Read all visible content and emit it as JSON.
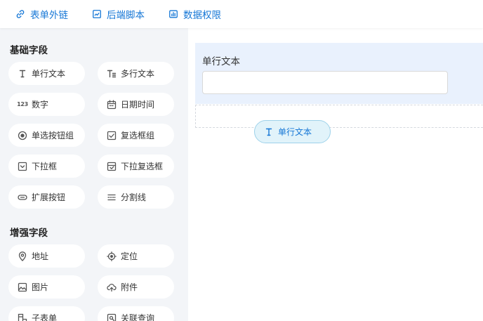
{
  "toolbar": {
    "items": [
      {
        "label": "表单外链",
        "icon": "link-icon"
      },
      {
        "label": "后端脚本",
        "icon": "script-icon"
      },
      {
        "label": "数据权限",
        "icon": "bar-chart-icon"
      }
    ]
  },
  "palette": {
    "sections": [
      {
        "title": "基础字段",
        "items": [
          {
            "label": "单行文本",
            "icon": "single-line-text-icon"
          },
          {
            "label": "多行文本",
            "icon": "multi-line-text-icon"
          },
          {
            "label": "数字",
            "icon": "number-icon",
            "icon_text": "123"
          },
          {
            "label": "日期时间",
            "icon": "calendar-icon"
          },
          {
            "label": "单选按钮组",
            "icon": "radio-icon"
          },
          {
            "label": "复选框组",
            "icon": "checkbox-icon"
          },
          {
            "label": "下拉框",
            "icon": "dropdown-icon"
          },
          {
            "label": "下拉复选框",
            "icon": "dropdown-checkbox-icon"
          },
          {
            "label": "扩展按钮",
            "icon": "extend-button-icon"
          },
          {
            "label": "分割线",
            "icon": "divider-icon"
          }
        ]
      },
      {
        "title": "增强字段",
        "items": [
          {
            "label": "地址",
            "icon": "location-pin-icon"
          },
          {
            "label": "定位",
            "icon": "crosshair-icon"
          },
          {
            "label": "图片",
            "icon": "image-icon"
          },
          {
            "label": "附件",
            "icon": "cloud-upload-icon"
          },
          {
            "label": "子表单",
            "icon": "sub-form-icon"
          },
          {
            "label": "关联查询",
            "icon": "linked-query-icon"
          }
        ]
      }
    ]
  },
  "canvas": {
    "field": {
      "label": "单行文本",
      "value": "",
      "placeholder": ""
    },
    "drag_chip": {
      "label": "单行文本",
      "icon": "single-line-text-icon"
    }
  },
  "colors": {
    "accent": "#1677d6",
    "sidebar_bg": "#f3f5f8",
    "selected_field_bg": "#e9f1fd",
    "drag_chip_bg": "#e1f3fa",
    "drag_chip_border": "#9ed2ea"
  }
}
